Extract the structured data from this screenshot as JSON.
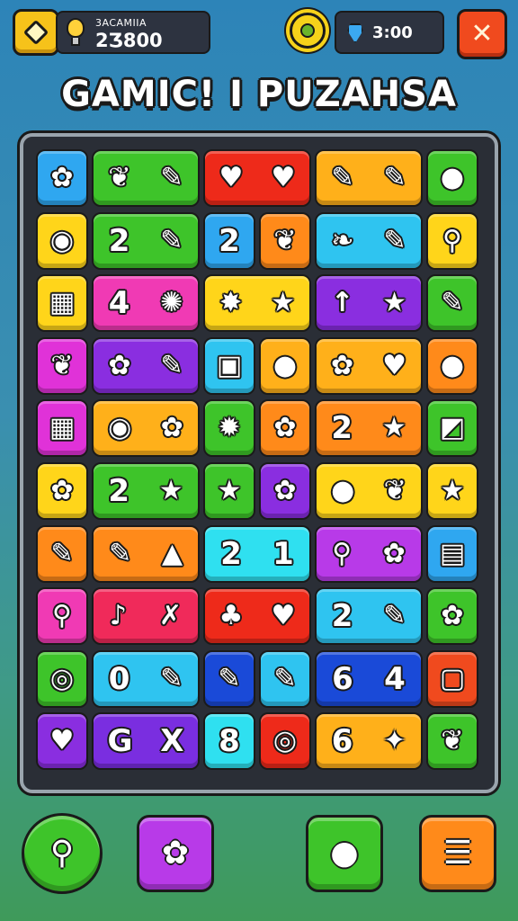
{
  "header": {
    "score_label": "3ACAMIIA",
    "score_value": "2Ʒ800",
    "gems_value": "3:00",
    "close_symbol": "✕"
  },
  "title": "GAMIC! I PUZAHSA",
  "board": {
    "rows": [
      [
        {
          "color": "#2fa7f0",
          "span": 1,
          "content": [
            "✿"
          ]
        },
        {
          "color": "#3ec42a",
          "span": 2,
          "content": [
            "❦",
            "✎"
          ]
        },
        {
          "color": "#ee2a1a",
          "span": 2,
          "content": [
            "♥",
            "♥"
          ]
        },
        {
          "color": "#ffb01a",
          "span": 2,
          "content": [
            "✎",
            "✎"
          ]
        },
        {
          "color": "#3ec42a",
          "span": 1,
          "content": [
            "●"
          ]
        }
      ],
      [
        {
          "color": "#ffd51a",
          "span": 1,
          "content": [
            "◉"
          ]
        },
        {
          "color": "#3ec42a",
          "span": 2,
          "content": [
            "2",
            "✎"
          ]
        },
        {
          "color": "#2fa7f0",
          "span": 1,
          "content": [
            "2"
          ]
        },
        {
          "color": "#ff8a1a",
          "span": 1,
          "content": [
            "❦"
          ]
        },
        {
          "color": "#2fc4f0",
          "span": 2,
          "content": [
            "❧",
            "✎"
          ]
        },
        {
          "color": "#ffd51a",
          "span": 1,
          "content": [
            "⚲"
          ]
        }
      ],
      [
        {
          "color": "#ffd51a",
          "span": 1,
          "content": [
            "▦"
          ]
        },
        {
          "color": "#f03ab4",
          "span": 2,
          "content": [
            "4",
            "✺"
          ]
        },
        {
          "color": "#ffd51a",
          "span": 2,
          "content": [
            "✸",
            "★"
          ]
        },
        {
          "color": "#8a2ee0",
          "span": 2,
          "content": [
            "↑",
            "★"
          ]
        },
        {
          "color": "#3ec42a",
          "span": 1,
          "content": [
            "✎"
          ]
        }
      ],
      [
        {
          "color": "#e032d8",
          "span": 1,
          "content": [
            "❦"
          ]
        },
        {
          "color": "#8a2ee0",
          "span": 2,
          "content": [
            "✿",
            "✎"
          ]
        },
        {
          "color": "#2fc4f0",
          "span": 1,
          "content": [
            "▣"
          ]
        },
        {
          "color": "#ffb01a",
          "span": 1,
          "content": [
            "●"
          ]
        },
        {
          "color": "#ffb01a",
          "span": 2,
          "content": [
            "✿",
            "♥"
          ]
        },
        {
          "color": "#ff8a1a",
          "span": 1,
          "content": [
            "●"
          ]
        }
      ],
      [
        {
          "color": "#e032d8",
          "span": 1,
          "content": [
            "▦"
          ]
        },
        {
          "color": "#ffb01a",
          "span": 2,
          "content": [
            "◉",
            "✿"
          ]
        },
        {
          "color": "#3ec42a",
          "span": 1,
          "content": [
            "✹"
          ]
        },
        {
          "color": "#ff8a1a",
          "span": 1,
          "content": [
            "✿"
          ]
        },
        {
          "color": "#ff8a1a",
          "span": 2,
          "content": [
            "2",
            "★"
          ]
        },
        {
          "color": "#3ec42a",
          "span": 1,
          "content": [
            "◩"
          ]
        }
      ],
      [
        {
          "color": "#ffd51a",
          "span": 1,
          "content": [
            "✿"
          ]
        },
        {
          "color": "#3ec42a",
          "span": 2,
          "content": [
            "2",
            "★"
          ]
        },
        {
          "color": "#3ec42a",
          "span": 1,
          "content": [
            "★"
          ]
        },
        {
          "color": "#8a2ee0",
          "span": 1,
          "content": [
            "✿"
          ]
        },
        {
          "color": "#ffd51a",
          "span": 2,
          "content": [
            "●",
            "❦"
          ]
        },
        {
          "color": "#ffd51a",
          "span": 1,
          "content": [
            "★"
          ]
        }
      ],
      [
        {
          "color": "#ff8a1a",
          "span": 1,
          "content": [
            "✎"
          ]
        },
        {
          "color": "#ff8a1a",
          "span": 2,
          "content": [
            "✎",
            "▲"
          ]
        },
        {
          "color": "#2fe0f0",
          "span": 2,
          "content": [
            "2",
            "1"
          ]
        },
        {
          "color": "#b83ae8",
          "span": 2,
          "content": [
            "⚲",
            "✿"
          ]
        },
        {
          "color": "#2fa7f0",
          "span": 1,
          "content": [
            "▤"
          ]
        }
      ],
      [
        {
          "color": "#f03ab4",
          "span": 1,
          "content": [
            "⚲"
          ]
        },
        {
          "color": "#f02a5a",
          "span": 2,
          "content": [
            "♪",
            "✗"
          ]
        },
        {
          "color": "#ee2a1a",
          "span": 2,
          "content": [
            "♣",
            "♥"
          ]
        },
        {
          "color": "#2fc4f0",
          "span": 2,
          "content": [
            "2",
            "✎"
          ]
        },
        {
          "color": "#3ec42a",
          "span": 1,
          "content": [
            "✿"
          ]
        }
      ],
      [
        {
          "color": "#3ec42a",
          "span": 1,
          "content": [
            "◎"
          ]
        },
        {
          "color": "#2fc4f0",
          "span": 2,
          "content": [
            "0",
            "✎"
          ]
        },
        {
          "color": "#1a4ad8",
          "span": 1,
          "content": [
            "✎"
          ]
        },
        {
          "color": "#2fc4f0",
          "span": 1,
          "content": [
            "✎"
          ]
        },
        {
          "color": "#1a4ad8",
          "span": 2,
          "content": [
            "6",
            "4"
          ]
        },
        {
          "color": "#f04a1e",
          "span": 1,
          "content": [
            "▢"
          ]
        }
      ],
      [
        {
          "color": "#8a2ee0",
          "span": 1,
          "content": [
            "♥"
          ]
        },
        {
          "color": "#7a2ee0",
          "span": 2,
          "content": [
            "G",
            "X"
          ]
        },
        {
          "color": "#2fe0f0",
          "span": 1,
          "content": [
            "8"
          ]
        },
        {
          "color": "#ee2a1a",
          "span": 1,
          "content": [
            "◎"
          ]
        },
        {
          "color": "#ffb01a",
          "span": 2,
          "content": [
            "6",
            "✦"
          ]
        },
        {
          "color": "#3ec42a",
          "span": 1,
          "content": [
            "❦"
          ]
        }
      ]
    ]
  },
  "buttons": [
    {
      "name": "magnifier-button",
      "color": "#3ec42a",
      "shape": "circle",
      "icon": "magnifier-icon",
      "glyph": "⚲"
    },
    {
      "name": "flower-button",
      "color": "#b83ae8",
      "shape": "square",
      "icon": "flower-icon",
      "glyph": "✿"
    },
    {
      "name": "chat-button",
      "color": "#3ec42a",
      "shape": "square",
      "icon": "speech-bubble-icon",
      "glyph": "●"
    },
    {
      "name": "menu-button",
      "color": "#ff8a1a",
      "shape": "square",
      "icon": "menu-icon",
      "glyph": "☰"
    }
  ]
}
